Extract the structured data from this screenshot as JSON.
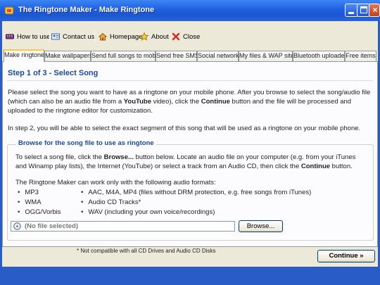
{
  "window": {
    "title": "The Ringtone Maker - Make Ringtone"
  },
  "menu": {
    "how_to_use": "How to use",
    "contact_us": "Contact us",
    "homepage": "Homepage",
    "about": "About",
    "close": "Close"
  },
  "tabs": [
    "Make ringtone",
    "Make wallpapers",
    "Send full songs to mobile",
    "Send free SMS",
    "Social network",
    "My files & WAP site",
    "Bluetooth uploader",
    "Free items"
  ],
  "active_tab": "Make ringtone",
  "step": {
    "title": "Step 1 of 3 - Select Song",
    "para1_a": "Please select the song you want to have as a ringtone on your mobile phone. After you browse to select the song/audio file (which can also be an audio file from a ",
    "para1_youtube": "YouTube",
    "para1_b": " video), click the ",
    "para1_continue": "Continue",
    "para1_c": " button and the file will be processed and uploaded to the ringtone editor for customization.",
    "para2": "In step 2, you will be able to select the exact segment of this song that will be used as a ringtone on your mobile phone."
  },
  "browse_group": {
    "legend": "Browse for the song file to use as ringtone",
    "text_a": "To select a song file, click the ",
    "text_browse": "Browse...",
    "text_b": " button below. Locate an audio file on your computer (e.g. from your iTunes and Winamp play lists), the Internet (YouTube) or select a track from an Audio CD, then click the ",
    "text_continue": "Continue",
    "text_c": " button.",
    "formats_intro": "The Ringtone Maker can work only with the following audio formats:",
    "formats_left": [
      "MP3",
      "WMA",
      "OGG/Vorbis"
    ],
    "formats_right": [
      "AAC, M4A, MP4 (files without DRM protection, e.g. free songs from iTunes)",
      "Audio CD Tracks*",
      "WAV (including your own voice/recordings)"
    ],
    "file_value": "(No file selected)",
    "browse_button": "Browse..."
  },
  "footer_note": "* Not compatible with all CD Drives and Audio CD Disks",
  "continue_button": "Continue »",
  "colors": {
    "titlebar": "#1f5fe0",
    "heading": "#1a4aa0",
    "panel": "#ece9d8",
    "tab_highlight": "#ffc83c"
  }
}
